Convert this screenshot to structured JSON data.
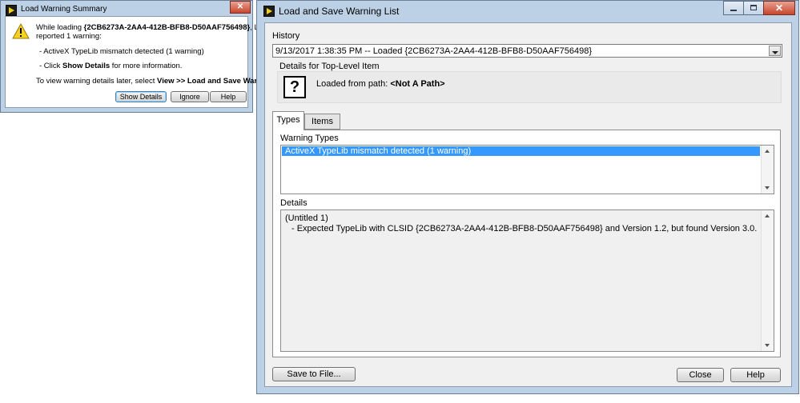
{
  "summary_dialog": {
    "title": "Load Warning Summary",
    "line1_prefix": "While loading ",
    "line1_id": "{2CB6273A-2AA4-412B-BFB8-D50AAF756498}",
    "line1_suffix": ", LabVIEW",
    "line2": "reported 1 warning:",
    "bullet1": "- ActiveX TypeLib mismatch detected (1 warning)",
    "bullet2_prefix": "- Click ",
    "bullet2_bold": "Show Details",
    "bullet2_suffix": " for more information.",
    "hint_prefix": "To view warning details later, select ",
    "hint_bold": "View >> Load and Save Warning List.",
    "buttons": {
      "show_details": "Show Details",
      "ignore": "Ignore",
      "help": "Help"
    },
    "icons": {
      "app": "labview-icon",
      "warning": "warning-icon"
    }
  },
  "main_window": {
    "title": "Load and Save Warning List",
    "history_label": "History",
    "history_value": "9/13/2017 1:38:35 PM -- Loaded {2CB6273A-2AA4-412B-BFB8-D50AAF756498}",
    "details_top_label": "Details for Top-Level Item",
    "loaded_path_prefix": "Loaded from path: ",
    "loaded_path_value": "<Not A Path>",
    "tabs": [
      {
        "label": "Types"
      },
      {
        "label": "Items"
      }
    ],
    "warning_types_label": "Warning Types",
    "warning_types": [
      "ActiveX TypeLib mismatch detected (1 warning)"
    ],
    "details_label": "Details",
    "details_lines": [
      "(Untitled 1)",
      "- Expected TypeLib with CLSID {2CB6273A-2AA4-412B-BFB8-D50AAF756498} and Version 1.2, but found Version 3.0."
    ],
    "buttons": {
      "save": "Save to File...",
      "close": "Close",
      "help": "Help"
    },
    "caption_close_glyph": "✕"
  },
  "colors": {
    "selection": "#3399ff",
    "titlebar": "#bcd0e6",
    "close": "#c7452d"
  }
}
